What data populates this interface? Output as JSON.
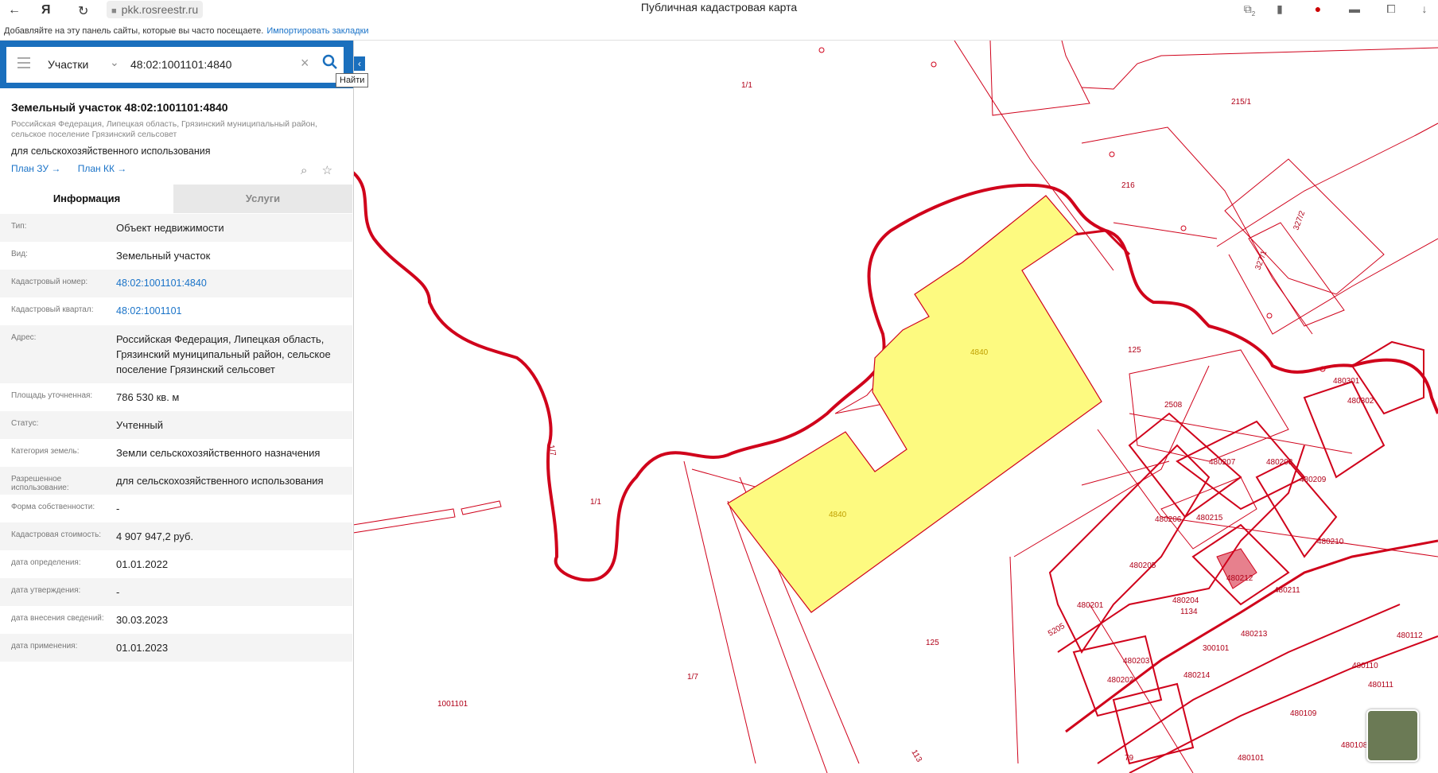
{
  "browser": {
    "url": "pkk.rosreestr.ru",
    "tab_title": "Публичная кадастровая карта",
    "bookmarks_text": "Добавляйте на эту панель сайты, которые вы часто посещаете.",
    "bookmarks_link": "Импортировать закладки",
    "ext_badge": "2"
  },
  "search": {
    "category": "Участки",
    "query": "48:02:1001101:4840",
    "tooltip": "Найти"
  },
  "parcel": {
    "title": "Земельный участок 48:02:1001101:4840",
    "address": "Российская Федерация, Липецкая область, Грязинский муниципальный район, сельское поселение Грязинский сельсовет",
    "use": "для сельскохозяйственного использования",
    "plan_zu": "План ЗУ →",
    "plan_kk": "План КК →"
  },
  "tabs": {
    "info": "Информация",
    "services": "Услуги"
  },
  "rows": [
    {
      "label": "Тип:",
      "value": "Объект недвижимости"
    },
    {
      "label": "Вид:",
      "value": "Земельный участок"
    },
    {
      "label": "Кадастровый номер:",
      "value": "48:02:1001101:4840",
      "link": true
    },
    {
      "label": "Кадастровый квартал:",
      "value": "48:02:1001101",
      "link": true
    },
    {
      "label": "Адрес:",
      "value": "Российская Федерация, Липецкая область, Грязинский муниципальный район, сельское поселение Грязинский сельсовет"
    },
    {
      "label": "Площадь уточненная:",
      "value": "786 530 кв. м"
    },
    {
      "label": "Статус:",
      "value": "Учтенный"
    },
    {
      "label": "Категория земель:",
      "value": "Земли сельскохозяйственного назначения"
    },
    {
      "label": "Разрешенное использование:",
      "value": "для сельскохозяйственного использования"
    },
    {
      "label": "Форма собственности:",
      "value": "-"
    },
    {
      "label": "Кадастровая стоимость:",
      "value": "4 907 947,2 руб."
    },
    {
      "label": "дата определения:",
      "value": "01.01.2022"
    },
    {
      "label": "дата утверждения:",
      "value": "-"
    },
    {
      "label": "дата внесения сведений:",
      "value": "30.03.2023"
    },
    {
      "label": "дата применения:",
      "value": "01.01.2023"
    }
  ],
  "map_labels": [
    "1/1",
    "215/1",
    "216",
    "327/2",
    "327/1",
    "4840",
    "125",
    "2508",
    "480301",
    "480302",
    "1/7",
    "1/1",
    "4840",
    "480207",
    "480208",
    "480209",
    "480206",
    "480215",
    "480210",
    "480205",
    "480212",
    "480211",
    "480201",
    "480204",
    "1134",
    "5205",
    "480213",
    "125",
    "480203",
    "300101",
    "480214",
    "480202",
    "480110",
    "480111",
    "480112",
    "1001101",
    "1/7",
    "480109",
    "480108",
    "480101",
    "113",
    "79"
  ],
  "colors": {
    "boundary": "#d0021b",
    "parcel_fill": "#fdfa80",
    "accent": "#1a6fbd"
  }
}
